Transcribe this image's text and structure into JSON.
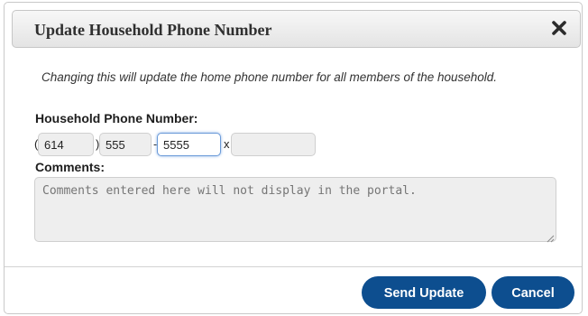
{
  "dialog": {
    "title": "Update Household Phone Number",
    "close_icon": "close-x-icon",
    "info_text": "Changing this will update the home phone number for all members of the household."
  },
  "phone": {
    "label": "Household Phone Number:",
    "open_paren": "(",
    "close_paren": ")",
    "dash": "-",
    "ext_prefix": "x",
    "area_code": "614",
    "prefix": "555",
    "line": "5555",
    "extension": ""
  },
  "comments": {
    "label": "Comments:",
    "placeholder": "Comments entered here will not display in the portal."
  },
  "buttons": {
    "send_label": "Send Update",
    "cancel_label": "Cancel"
  },
  "colors": {
    "button_bg": "#0d4e8f",
    "focus_border": "#6a9ad8"
  }
}
